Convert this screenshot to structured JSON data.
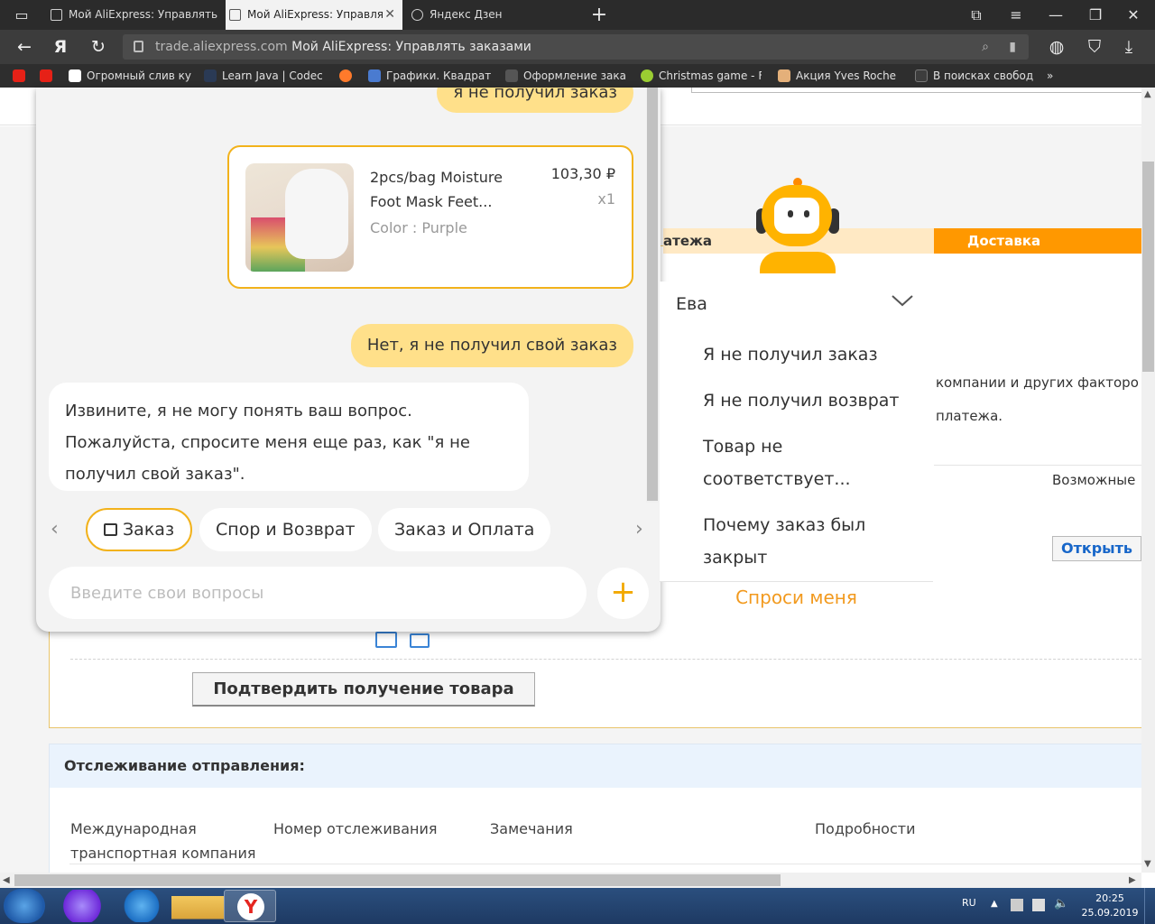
{
  "browser": {
    "tabs": [
      {
        "title": "Мой AliExpress: Управлять",
        "active": false
      },
      {
        "title": "Мой AliExpress: Управля",
        "active": true
      },
      {
        "title": "Яндекс Дзен",
        "active": false
      }
    ],
    "url_domain": "trade.aliexpress.com",
    "page_title": "Мой AliExpress: Управлять заказами",
    "bookmarks": [
      "Огромный слив ку",
      "Learn Java | Codec",
      "Графики. Квадрат",
      "Оформление зака",
      "Christmas game - F",
      "Акция Yves Roche",
      "В поисках свобод"
    ],
    "yandex_letter": "Я"
  },
  "order": {
    "progress_payment": "атежа",
    "progress_delivery": "Доставка",
    "side_text_1": "компании и других факторо",
    "side_text_2": "платежа.",
    "side_text_3": "Возможные",
    "open_button": "Открыть",
    "confirm_button": "Подтвердить получение товара"
  },
  "tracking": {
    "title": "Отслеживание отправления:",
    "columns": [
      "Международная транспортная компания",
      "Номер отслеживания",
      "Замечания",
      "Подробности"
    ]
  },
  "chat": {
    "user_message_top": "я не получил заказ",
    "product": {
      "title": "2pcs/bag Moisture Foot Mask Feet...",
      "color": "Color : Purple",
      "price": "103,30 ₽",
      "qty": "x1"
    },
    "user_message_no": "Нет, я не получил свой заказ",
    "bot_message": "Извините, я не могу понять ваш вопрос. Пожалуйста, спросите меня еще раз, как \"я не получил свой заказ\".",
    "categories": [
      "Заказ",
      "Спор и Возврат",
      "Заказ и Оплата"
    ],
    "input_placeholder": "Введите свои вопросы",
    "plus_label": "+"
  },
  "assistant_menu": {
    "title": "Ева",
    "items": [
      "Я не получил заказ",
      "Я не получил возврат",
      "Товар не соответствует...",
      "Почему заказ был закрыт"
    ],
    "ask_me": "Спроси меня"
  },
  "taskbar": {
    "lang": "RU",
    "time": "20:25",
    "date": "25.09.2019"
  },
  "colors": {
    "accent_yellow": "#f2b21b",
    "bubble_user": "#ffe08a",
    "delivery_orange": "#ff9800",
    "link_blue": "#1766c9"
  }
}
